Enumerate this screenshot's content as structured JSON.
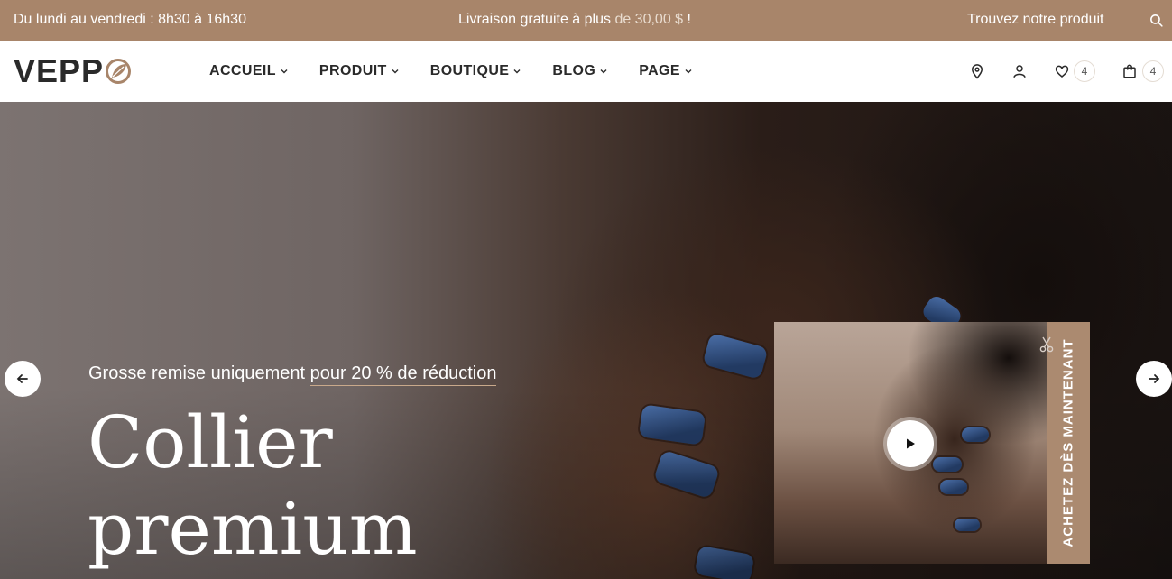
{
  "topbar": {
    "hours": "Du lundi au vendredi : 8h30 à 16h30",
    "shipping_prefix": "Livraison gratuite à plus",
    "shipping_amount": "de 30,00 $",
    "shipping_suffix": "!",
    "find_product": "Trouvez notre produit"
  },
  "header": {
    "logo_text": "VEPP",
    "nav": [
      {
        "label": "ACCUEIL"
      },
      {
        "label": "PRODUIT"
      },
      {
        "label": "BOUTIQUE"
      },
      {
        "label": "BLOG"
      },
      {
        "label": "PAGE"
      }
    ],
    "wishlist_count": "4",
    "cart_count": "4"
  },
  "hero": {
    "subtitle_prefix": "Grosse remise uniquement",
    "subtitle_highlight": "pour 20 % de réduction",
    "title_line1": "Collier",
    "title_line2": "premium",
    "shop_now": "ACHETEZ DÈS MAINTENANT"
  },
  "colors": {
    "topbar_bg": "#a8856a",
    "accent": "#ab8a70",
    "text_dark": "#2a2a2a"
  }
}
